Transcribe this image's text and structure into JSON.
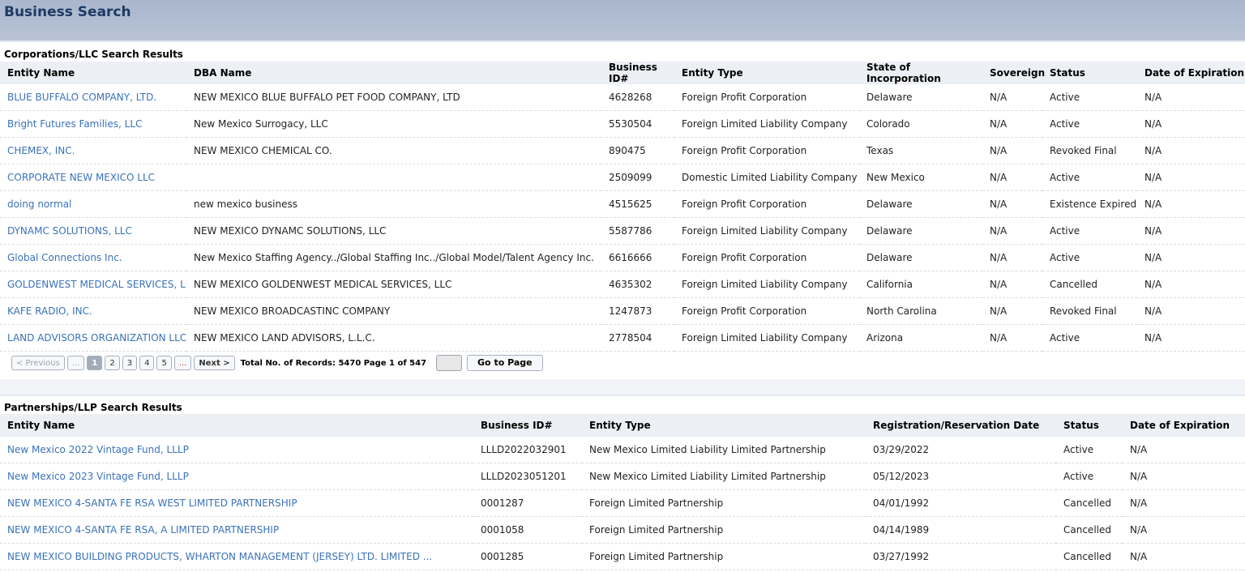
{
  "page": {
    "title": "Business Search"
  },
  "corporations": {
    "title": "Corporations/LLC Search Results",
    "columns": [
      "Entity Name",
      "DBA Name",
      "Business ID#",
      "Entity Type",
      "State of Incorporation",
      "Sovereign",
      "Status",
      "Date of Expiration"
    ],
    "rows": [
      [
        "BLUE BUFFALO COMPANY, LTD.",
        "NEW MEXICO BLUE BUFFALO PET FOOD COMPANY, LTD",
        "4628268",
        "Foreign Profit Corporation",
        "Delaware",
        "N/A",
        "Active",
        "N/A"
      ],
      [
        "Bright Futures Families, LLC",
        "New Mexico Surrogacy, LLC",
        "5530504",
        "Foreign Limited Liability Company",
        "Colorado",
        "N/A",
        "Active",
        "N/A"
      ],
      [
        "CHEMEX, INC.",
        "NEW MEXICO CHEMICAL CO.",
        "890475",
        "Foreign Profit Corporation",
        "Texas",
        "N/A",
        "Revoked Final",
        "N/A"
      ],
      [
        "CORPORATE NEW MEXICO LLC",
        "",
        "2509099",
        "Domestic Limited Liability Company",
        "New Mexico",
        "N/A",
        "Active",
        "N/A"
      ],
      [
        "doing normal",
        "new mexico business",
        "4515625",
        "Foreign Profit Corporation",
        "Delaware",
        "N/A",
        "Existence Expired",
        "N/A"
      ],
      [
        "DYNAMC SOLUTIONS, LLC",
        "NEW MEXICO DYNAMC SOLUTIONS, LLC",
        "5587786",
        "Foreign Limited Liability Company",
        "Delaware",
        "N/A",
        "Active",
        "N/A"
      ],
      [
        "Global Connections Inc.",
        "New Mexico Staffing Agency../Global Staffing Inc../Global Model/Talent Agency Inc.",
        "6616666",
        "Foreign Profit Corporation",
        "Delaware",
        "N/A",
        "Active",
        "N/A"
      ],
      [
        "GOLDENWEST MEDICAL SERVICES, LLC",
        "NEW MEXICO GOLDENWEST MEDICAL SERVICES, LLC",
        "4635302",
        "Foreign Limited Liability Company",
        "California",
        "N/A",
        "Cancelled",
        "N/A"
      ],
      [
        "KAFE RADIO, INC.",
        "NEW MEXICO BROADCASTINC COMPANY",
        "1247873",
        "Foreign Profit Corporation",
        "North Carolina",
        "N/A",
        "Revoked Final",
        "N/A"
      ],
      [
        "LAND ADVISORS ORGANIZATION LLC",
        "NEW MEXICO LAND ADVISORS, L.L.C.",
        "2778504",
        "Foreign Limited Liability Company",
        "Arizona",
        "N/A",
        "Active",
        "N/A"
      ]
    ],
    "pager": {
      "prev": "< Previous",
      "ellipsis_left": "...",
      "pages": [
        "1",
        "2",
        "3",
        "4",
        "5"
      ],
      "ellipsis_right": "...",
      "next": "Next >",
      "records": "Total No. of Records: 5470 Page 1 of 547",
      "go": "Go to Page",
      "page_input": ""
    }
  },
  "partnerships": {
    "title": "Partnerships/LLP Search Results",
    "columns": [
      "Entity Name",
      "Business ID#",
      "Entity Type",
      "Registration/Reservation Date",
      "Status",
      "Date of Expiration"
    ],
    "rows": [
      [
        "New Mexico 2022 Vintage Fund, LLLP",
        "LLLD2022032901",
        "New Mexico Limited Liability Limited Partnership",
        "03/29/2022",
        "Active",
        "N/A"
      ],
      [
        "New Mexico 2023 Vintage Fund, LLLP",
        "LLLD2023051201",
        "New Mexico Limited Liability Limited Partnership",
        "05/12/2023",
        "Active",
        "N/A"
      ],
      [
        "NEW MEXICO 4-SANTA FE RSA WEST LIMITED PARTNERSHIP",
        "0001287",
        "Foreign Limited Partnership",
        "04/01/1992",
        "Cancelled",
        "N/A"
      ],
      [
        "NEW MEXICO 4-SANTA FE RSA, A LIMITED PARTNERSHIP",
        "0001058",
        "Foreign Limited Partnership",
        "04/14/1989",
        "Cancelled",
        "N/A"
      ],
      [
        "NEW MEXICO BUILDING PRODUCTS, WHARTON MANAGEMENT (JERSEY) LTD. LIMITED ...",
        "0001285",
        "Foreign Limited Partnership",
        "03/27/1992",
        "Cancelled",
        "N/A"
      ]
    ]
  }
}
